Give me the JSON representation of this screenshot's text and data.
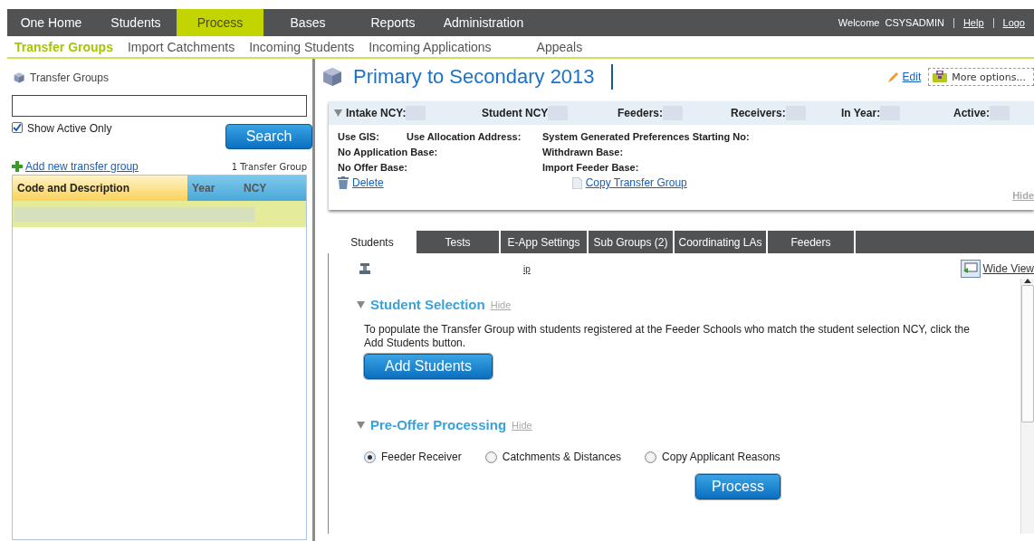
{
  "top_nav": {
    "items": [
      {
        "label": "One Home",
        "selected": false
      },
      {
        "label": "Students",
        "selected": false
      },
      {
        "label": "Process",
        "selected": true
      },
      {
        "label": "Bases",
        "selected": false
      },
      {
        "label": "Reports",
        "selected": false
      },
      {
        "label": "Administration",
        "selected": false
      }
    ],
    "welcome": "Welcome",
    "user": "CSYSADMIN",
    "links": [
      "Help",
      "Logo"
    ]
  },
  "sub_nav": {
    "items": [
      {
        "label": "Transfer Groups",
        "selected": true
      },
      {
        "label": "Import Catchments",
        "selected": false
      },
      {
        "label": "Incoming Students",
        "selected": false
      },
      {
        "label": "Incoming Applications",
        "selected": false
      },
      {
        "label": "Appeals",
        "selected": false
      }
    ]
  },
  "sidebar": {
    "title": "Transfer Groups",
    "show_active_only": {
      "label": "Show Active Only",
      "checked": true
    },
    "search_button": "Search",
    "add_link": "Add new transfer group",
    "count": "1 Transfer Group",
    "table": {
      "columns": [
        "Code and Description",
        "Year",
        "NCY"
      ],
      "rows": [
        {
          "selected": true
        }
      ]
    }
  },
  "main": {
    "title": "Primary to Secondary 2013",
    "edit": "Edit",
    "more_options": "More options...",
    "summary_fields": [
      "Intake NCY:",
      "Student NCY",
      "Feeders:",
      "Receivers:",
      "In Year:",
      "Active:"
    ],
    "details": [
      [
        "Use GIS:",
        "Use Allocation Address:",
        "System Generated Preferences Starting No:"
      ],
      [
        "No Application Base:",
        "Withdrawn Base:"
      ],
      [
        "No Offer Base:",
        "Import Feeder Base:"
      ]
    ],
    "delete_link": "Delete",
    "copy_link": "Copy Transfer Group",
    "hide_link": "Hide",
    "tabs": [
      {
        "label": "Students",
        "selected": true
      },
      {
        "label": "Tests",
        "selected": false
      },
      {
        "label": "E-App Settings",
        "selected": false
      },
      {
        "label": "Sub Groups  (2)",
        "selected": false
      },
      {
        "label": "Coordinating LAs",
        "selected": false
      },
      {
        "label": "Feeders",
        "selected": false
      }
    ],
    "toolbar_link": "ip",
    "wide_view": "Wide View",
    "student_selection": {
      "title": "Student Selection",
      "hide": "Hide",
      "text": "To populate the Transfer Group with students registered at the Feeder Schools who match the student selection NCY, click the Add Students button.",
      "button": "Add Students"
    },
    "pre_offer": {
      "title": "Pre-Offer Processing",
      "hide": "Hide",
      "options": [
        {
          "label": "Feeder Receiver",
          "selected": true
        },
        {
          "label": "Catchments & Distances",
          "selected": false
        },
        {
          "label": "Copy Applicant Reasons",
          "selected": false
        }
      ],
      "button": "Process"
    }
  }
}
